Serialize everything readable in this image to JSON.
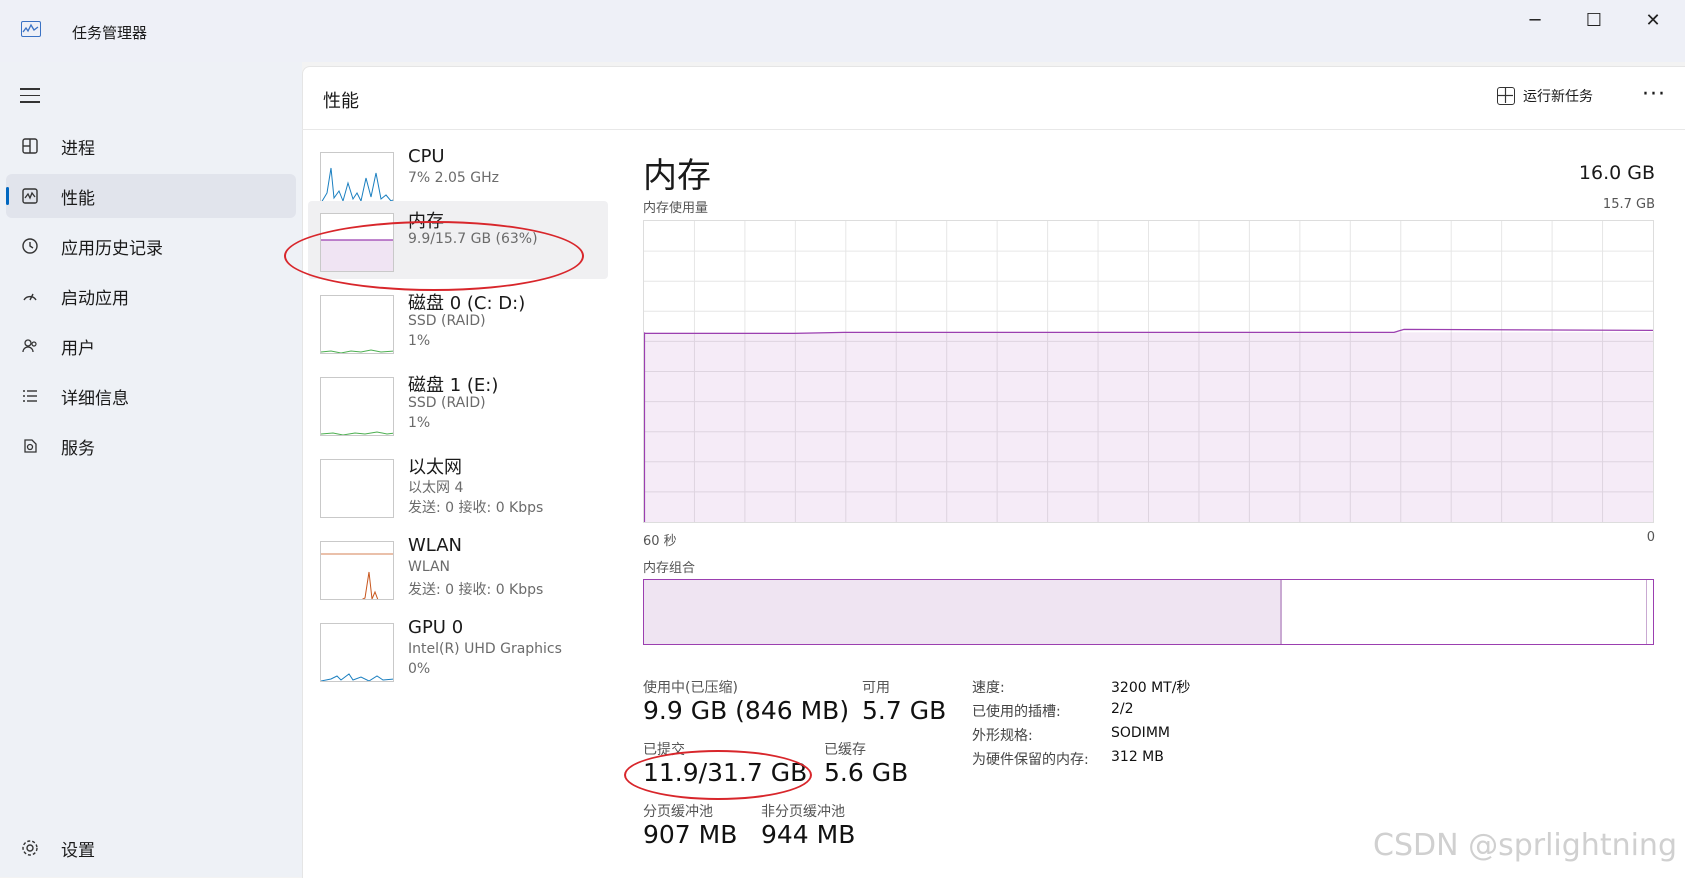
{
  "window": {
    "title": "任务管理器",
    "minimize": "─",
    "maximize": "☐",
    "close": "✕"
  },
  "nav": {
    "items": [
      {
        "label": "进程",
        "icon": "processes-icon"
      },
      {
        "label": "性能",
        "icon": "performance-icon"
      },
      {
        "label": "应用历史记录",
        "icon": "history-icon"
      },
      {
        "label": "启动应用",
        "icon": "startup-icon"
      },
      {
        "label": "用户",
        "icon": "users-icon"
      },
      {
        "label": "详细信息",
        "icon": "details-icon"
      },
      {
        "label": "服务",
        "icon": "services-icon"
      }
    ],
    "settings": "设置",
    "active_index": 1
  },
  "header": {
    "title": "性能",
    "run_new_task": "运行新任务",
    "more": "···"
  },
  "devices": [
    {
      "name": "CPU",
      "line1": "7% 2.05 GHz",
      "line2": ""
    },
    {
      "name": "内存",
      "line1": "9.9/15.7 GB (63%)",
      "line2": ""
    },
    {
      "name": "磁盘 0 (C: D:)",
      "line1": "SSD (RAID)",
      "line2": "1%"
    },
    {
      "name": "磁盘 1 (E:)",
      "line1": "SSD (RAID)",
      "line2": "1%"
    },
    {
      "name": "以太网",
      "line1": "以太网 4",
      "line2": "发送: 0 接收: 0 Kbps"
    },
    {
      "name": "WLAN",
      "line1": "WLAN",
      "line2": "发送: 0 接收: 0 Kbps"
    },
    {
      "name": "GPU 0",
      "line1": "Intel(R) UHD Graphics",
      "line2": "0%"
    }
  ],
  "memory": {
    "title": "内存",
    "total": "16.0 GB",
    "usage_label": "内存使用量",
    "usage_max": "15.7 GB",
    "time_left": "60 秒",
    "time_right": "0",
    "usage_fraction": 0.63,
    "composition_label": "内存组合",
    "composition_in_use_fraction": 0.63,
    "stats": {
      "in_use_label": "使用中(已压缩)",
      "in_use_value": "9.9 GB (846 MB)",
      "available_label": "可用",
      "available_value": "5.7 GB",
      "committed_label": "已提交",
      "committed_value": "11.9/31.7 GB",
      "cached_label": "已缓存",
      "cached_value": "5.6 GB",
      "paged_label": "分页缓冲池",
      "paged_value": "907 MB",
      "nonpaged_label": "非分页缓冲池",
      "nonpaged_value": "944 MB"
    },
    "details": [
      {
        "key": "速度:",
        "value": "3200 MT/秒"
      },
      {
        "key": "已使用的插槽:",
        "value": "2/2"
      },
      {
        "key": "外形规格:",
        "value": "SODIMM"
      },
      {
        "key": "为硬件保留的内存:",
        "value": "312 MB"
      }
    ]
  },
  "watermark": "CSDN @sprlightning",
  "colors": {
    "memory_accent": "#9b3fb0",
    "cpu_accent": "#1a7fc0",
    "disk_accent": "#4caf50",
    "wlan_accent": "#c8561d",
    "highlight_oval": "#d8262b"
  }
}
